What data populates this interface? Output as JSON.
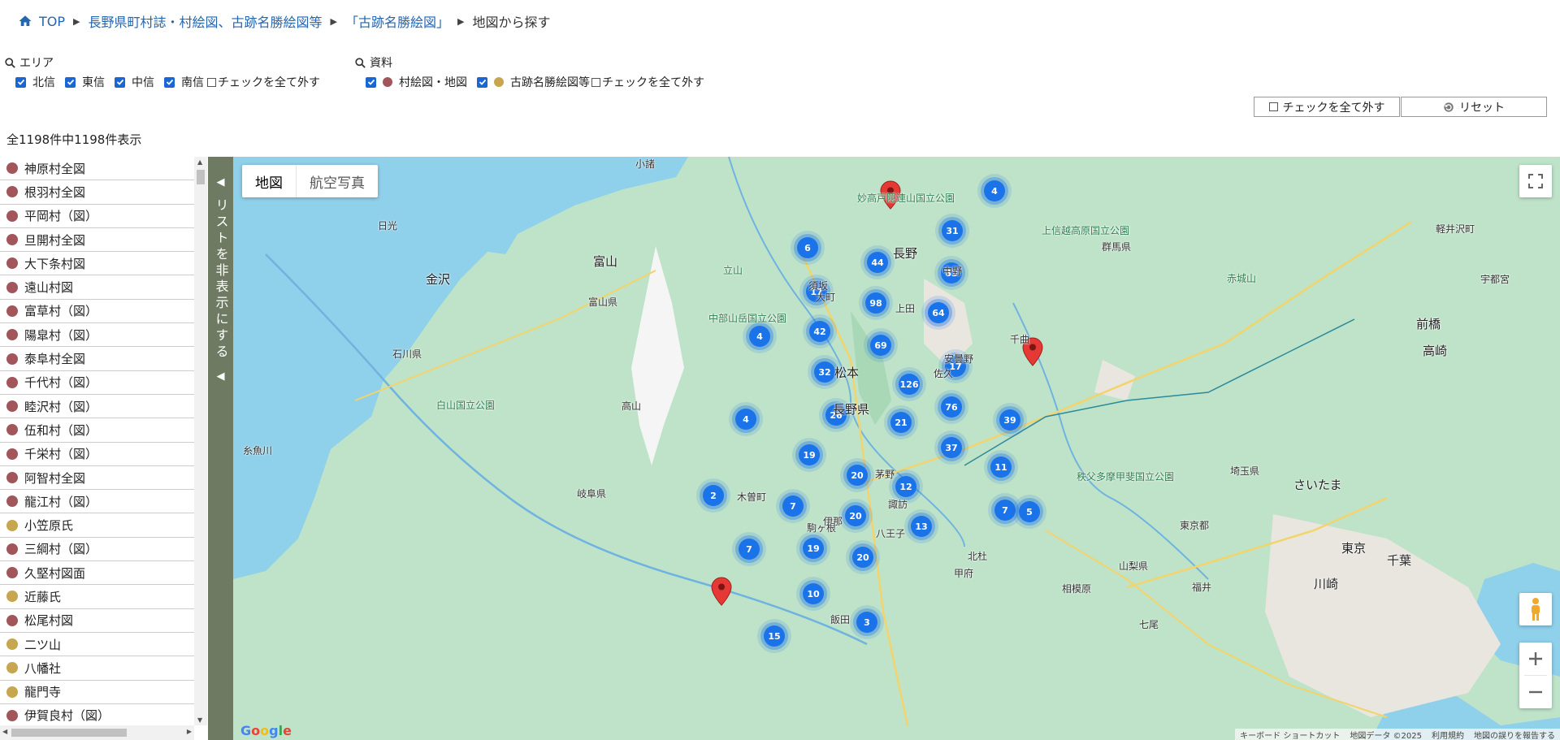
{
  "breadcrumb": {
    "home": "TOP",
    "crumb1": "長野県町村誌・村絵図、古跡名勝絵図等",
    "crumb2": "「古跡名勝絵図」",
    "current": "地図から探す"
  },
  "filters": {
    "area": {
      "title": "エリア",
      "options": [
        "北信",
        "東信",
        "中信",
        "南信"
      ],
      "uncheck_all": "チェックを全て外す"
    },
    "material": {
      "title": "資料",
      "options": [
        {
          "label": "村絵図・地図",
          "color": "#a0565a"
        },
        {
          "label": "古跡名勝絵図等",
          "color": "#c6a64e"
        }
      ],
      "uncheck_all": "チェックを全て外す"
    }
  },
  "buttons": {
    "uncheck_all": "チェックを全て外す",
    "reset": "リセット"
  },
  "count_text": "全1198件中1198件表示",
  "list": [
    {
      "label": "神原村全図",
      "type": "map"
    },
    {
      "label": "根羽村全図",
      "type": "map"
    },
    {
      "label": "平岡村（図）",
      "type": "map"
    },
    {
      "label": "旦開村全図",
      "type": "map"
    },
    {
      "label": "大下条村図",
      "type": "map"
    },
    {
      "label": "遠山村図",
      "type": "map"
    },
    {
      "label": "富草村（図）",
      "type": "map"
    },
    {
      "label": "陽皐村（図）",
      "type": "map"
    },
    {
      "label": "泰阜村全図",
      "type": "map"
    },
    {
      "label": "千代村（図）",
      "type": "map"
    },
    {
      "label": "睦沢村（図）",
      "type": "map"
    },
    {
      "label": "伍和村（図）",
      "type": "map"
    },
    {
      "label": "千栄村（図）",
      "type": "map"
    },
    {
      "label": "阿智村全図",
      "type": "map"
    },
    {
      "label": "龍江村（図）",
      "type": "map"
    },
    {
      "label": "小笠原氏",
      "type": "site"
    },
    {
      "label": "三綱村（図）",
      "type": "map"
    },
    {
      "label": "久堅村図面",
      "type": "map"
    },
    {
      "label": "近藤氏",
      "type": "site"
    },
    {
      "label": "松尾村図",
      "type": "map"
    },
    {
      "label": "二ツ山",
      "type": "site"
    },
    {
      "label": "八幡社",
      "type": "site"
    },
    {
      "label": "龍門寺",
      "type": "site"
    },
    {
      "label": "伊賀良村（図）",
      "type": "map"
    }
  ],
  "colors": {
    "map": "#a0565a",
    "site": "#c6a64e",
    "cluster": "#1a73e8",
    "pin": "#e53935",
    "sidebar": "#6f7a63"
  },
  "toggle": {
    "text": "リストを非表示にする"
  },
  "map": {
    "type_map": "地図",
    "type_satellite": "航空写真",
    "google": "Google",
    "attribution": [
      "キーボード ショートカット",
      "地図データ ©2025",
      "利用規約",
      "地図の誤りを報告する"
    ],
    "clusters": [
      "4",
      "31",
      "6",
      "44",
      "83",
      "17",
      "98",
      "64",
      "42",
      "4",
      "69",
      "17",
      "32",
      "126",
      "4",
      "26",
      "76",
      "21",
      "39",
      "19",
      "37",
      "11",
      "20",
      "12",
      "2",
      "7",
      "20",
      "7",
      "5",
      "13",
      "7",
      "19",
      "20",
      "10",
      "3",
      "15"
    ],
    "places": [
      "長野",
      "松本",
      "富山",
      "金沢",
      "前橋",
      "高崎",
      "さいたま",
      "東京",
      "川崎",
      "千葉",
      "長野県",
      "富山県",
      "石川県",
      "岐阜県",
      "群馬県",
      "埼玉県",
      "東京都",
      "山梨県",
      "中部山岳国立公園",
      "上信越高原国立公園",
      "白山国立公園",
      "妙高戸隠連山国立公園",
      "秩父多摩甲斐国立公園",
      "立山",
      "赤城山",
      "宇都宮",
      "高山",
      "飯田",
      "佐久",
      "上田",
      "諏訪",
      "伊那",
      "甲府",
      "八王子",
      "相模原",
      "福井",
      "七尾",
      "糸魚川",
      "日光",
      "小諸",
      "軽井沢町",
      "安曇野",
      "千曲",
      "須坂",
      "中野",
      "大町",
      "茅野",
      "駒ヶ根",
      "木曽町",
      "北杜"
    ]
  }
}
